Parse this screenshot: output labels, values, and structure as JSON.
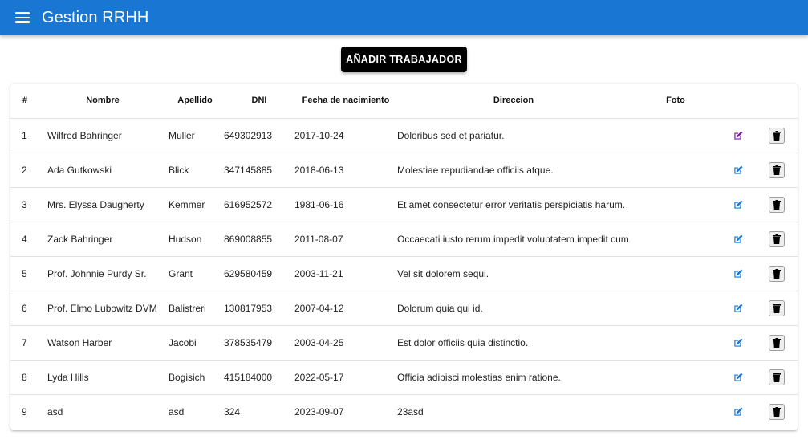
{
  "app": {
    "title": "Gestion RRHH",
    "accent": "#1976d2",
    "menu_icon": "hamburger-menu-icon"
  },
  "toolbar": {
    "add_label": "AÑADIR TRABAJADOR"
  },
  "table": {
    "headers": [
      "#",
      "Nombre",
      "Apellido",
      "DNI",
      "Fecha de nacimiento",
      "Direccion",
      "Foto"
    ],
    "rows": [
      {
        "id": "1",
        "nombre": "Wilfred Bahringer",
        "apellido": "Muller",
        "dni": "649302913",
        "fecha": "2017-10-24",
        "direccion": "Doloribus sed et pariatur.",
        "edit_color": "#7b1fa2"
      },
      {
        "id": "2",
        "nombre": "Ada Gutkowski",
        "apellido": "Blick",
        "dni": "347145885",
        "fecha": "2018-06-13",
        "direccion": "Molestiae repudiandae officiis atque.",
        "edit_color": "#1976d2"
      },
      {
        "id": "3",
        "nombre": "Mrs. Elyssa Daugherty",
        "apellido": "Kemmer",
        "dni": "616952572",
        "fecha": "1981-06-16",
        "direccion": "Et amet consectetur error veritatis perspiciatis harum.",
        "edit_color": "#1976d2"
      },
      {
        "id": "4",
        "nombre": "Zack Bahringer",
        "apellido": "Hudson",
        "dni": "869008855",
        "fecha": "2011-08-07",
        "direccion": "Occaecati iusto rerum impedit voluptatem impedit cum.",
        "edit_color": "#1976d2"
      },
      {
        "id": "5",
        "nombre": "Prof. Johnnie Purdy Sr.",
        "apellido": "Grant",
        "dni": "629580459",
        "fecha": "2003-11-21",
        "direccion": "Vel sit dolorem sequi.",
        "edit_color": "#1976d2"
      },
      {
        "id": "6",
        "nombre": "Prof. Elmo Lubowitz DVM",
        "apellido": "Balistreri",
        "dni": "130817953",
        "fecha": "2007-04-12",
        "direccion": "Dolorum quia qui id.",
        "edit_color": "#1976d2"
      },
      {
        "id": "7",
        "nombre": "Watson Harber",
        "apellido": "Jacobi",
        "dni": "378535479",
        "fecha": "2003-04-25",
        "direccion": "Est dolor officiis quia distinctio.",
        "edit_color": "#1976d2"
      },
      {
        "id": "8",
        "nombre": "Lyda Hills",
        "apellido": "Bogisich",
        "dni": "415184000",
        "fecha": "2022-05-17",
        "direccion": "Officia adipisci molestias enim ratione.",
        "edit_color": "#1976d2"
      },
      {
        "id": "9",
        "nombre": "asd",
        "apellido": "asd",
        "dni": "324",
        "fecha": "2023-09-07",
        "direccion": "23asd",
        "edit_color": "#1976d2"
      }
    ],
    "edit_icon": "edit-pencil-icon",
    "delete_icon": "trash-icon"
  }
}
